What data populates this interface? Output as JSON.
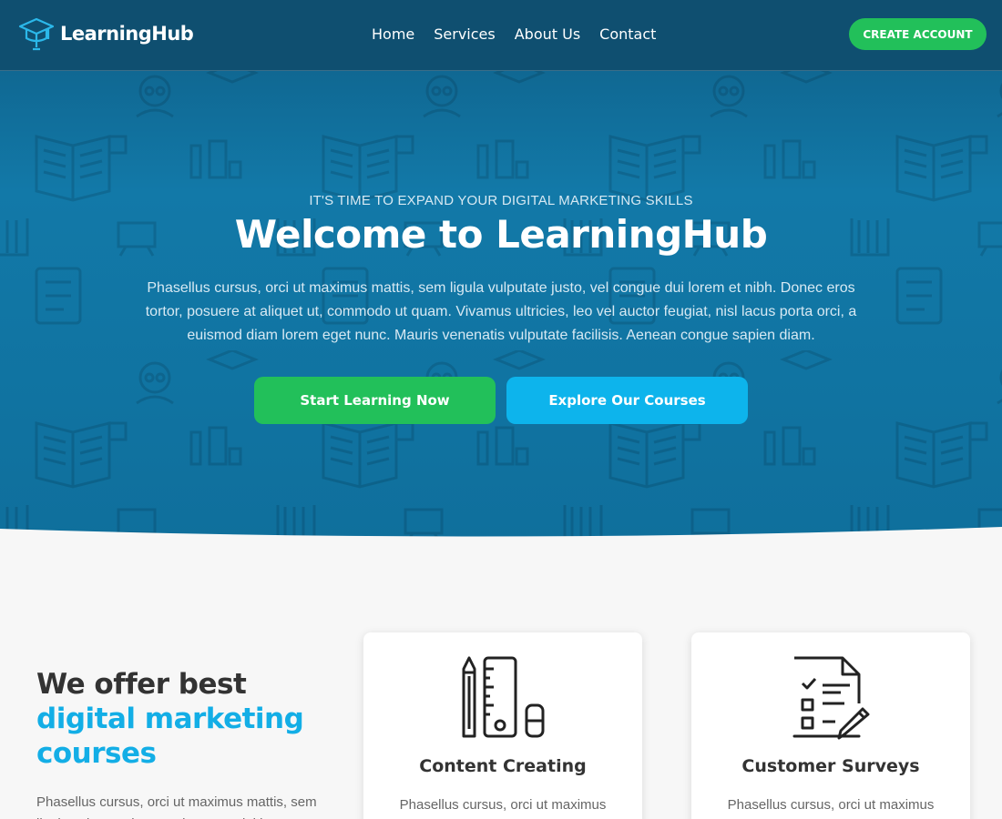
{
  "header": {
    "logo_text": "LearningHub",
    "nav": [
      "Home",
      "Services",
      "About Us",
      "Contact"
    ],
    "cta": "CREATE ACCOUNT"
  },
  "hero": {
    "eyebrow": "IT'S TIME TO EXPAND YOUR DIGITAL MARKETING SKILLS",
    "title": "Welcome to LearningHub",
    "description": "Phasellus cursus, orci ut maximus mattis, sem ligula vulputate justo, vel congue dui lorem et nibh. Donec eros tortor, posuere at aliquet ut, commodo ut quam. Vivamus ultricies, leo vel auctor feugiat, nisl lacus porta orci, a euismod diam lorem eget nunc. Mauris venenatis vulputate facilisis. Aenean congue sapien diam.",
    "primary_button": "Start Learning Now",
    "secondary_button": "Explore Our Courses"
  },
  "services": {
    "heading_plain": "We offer best ",
    "heading_highlight": "digital marketing courses",
    "intro_text": "Phasellus cursus, orci ut maximus mattis, sem ligula vulputate justo, vel congue dui lorem et nibh. Donec eros tortor, posuere at aliquet ut,",
    "cards": [
      {
        "icon": "pencil-ruler-icon",
        "title": "Content Creating",
        "text": "Phasellus cursus, orci ut maximus mattis,"
      },
      {
        "icon": "survey-checklist-icon",
        "title": "Customer Surveys",
        "text": "Phasellus cursus, orci ut maximus mattis,"
      }
    ]
  },
  "colors": {
    "accent_green": "#22c05a",
    "accent_blue": "#0db4ec",
    "hero_blue": "#1279a8",
    "header_bg": "#0f4f70"
  }
}
